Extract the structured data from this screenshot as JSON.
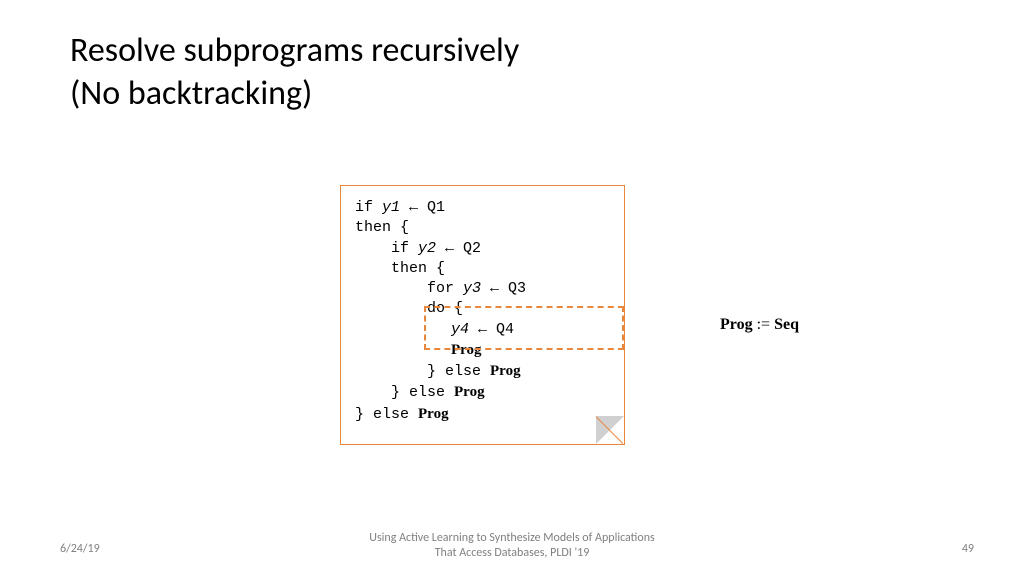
{
  "title": {
    "line1": "Resolve subprograms recursively",
    "line2": "(No backtracking)"
  },
  "code": {
    "l1_if": "if ",
    "l1_var": "y1",
    "l1_rest": " ← Q1",
    "l2": "then {",
    "l3_if": "if ",
    "l3_var": "y2",
    "l3_rest": " ← Q2",
    "l4": "then {",
    "l5_for": "for ",
    "l5_var": "y3",
    "l5_rest": " ← Q3",
    "l6": "do {",
    "l7_var": "y4",
    "l7_rest": " ← Q4",
    "l8_prog": "Prog",
    "l9_a": "} else ",
    "l9_b": "Prog",
    "l10_a": "} else ",
    "l10_b": "Prog",
    "l11_a": "} else ",
    "l11_b": "Prog"
  },
  "rule": {
    "lhs": "Prog",
    "op": " := ",
    "rhs": "Seq"
  },
  "footer": {
    "date": "6/24/19",
    "center_l1": "Using Active Learning to Synthesize Models of Applications",
    "center_l2": "That Access Databases, PLDI '19",
    "page": "49"
  }
}
